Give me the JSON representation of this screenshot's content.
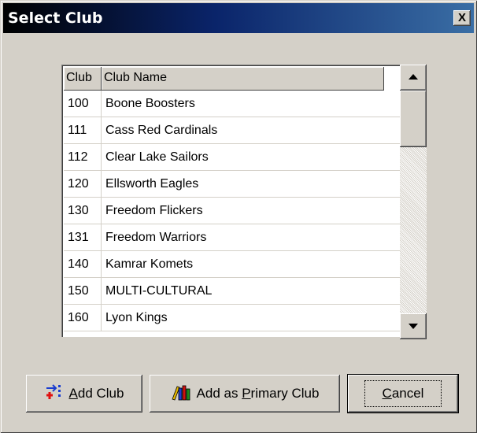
{
  "window": {
    "title": "Select Club",
    "close_label": "X"
  },
  "grid": {
    "columns": [
      "Club",
      "Club Name"
    ],
    "rows": [
      {
        "club": "100",
        "name": "Boone Boosters"
      },
      {
        "club": "111",
        "name": "Cass Red Cardinals"
      },
      {
        "club": "112",
        "name": "Clear Lake Sailors"
      },
      {
        "club": "120",
        "name": "Ellsworth Eagles"
      },
      {
        "club": "130",
        "name": "Freedom Flickers"
      },
      {
        "club": "131",
        "name": "Freedom Warriors"
      },
      {
        "club": "140",
        "name": "Kamrar Komets"
      },
      {
        "club": "150",
        "name": "MULTI-CULTURAL"
      },
      {
        "club": "160",
        "name": "Lyon Kings"
      }
    ]
  },
  "buttons": {
    "add_club": {
      "accel": "A",
      "rest": "dd Club"
    },
    "add_primary": {
      "pre": "Add as ",
      "accel": "P",
      "rest": "rimary Club"
    },
    "cancel": {
      "accel": "C",
      "rest": "ancel"
    }
  },
  "icons": {
    "add_club": "add-arrow-icon",
    "add_primary": "books-icon"
  },
  "colors": {
    "title_start": "#000000",
    "title_end": "#3a6ea5",
    "face": "#d4d0c8"
  }
}
